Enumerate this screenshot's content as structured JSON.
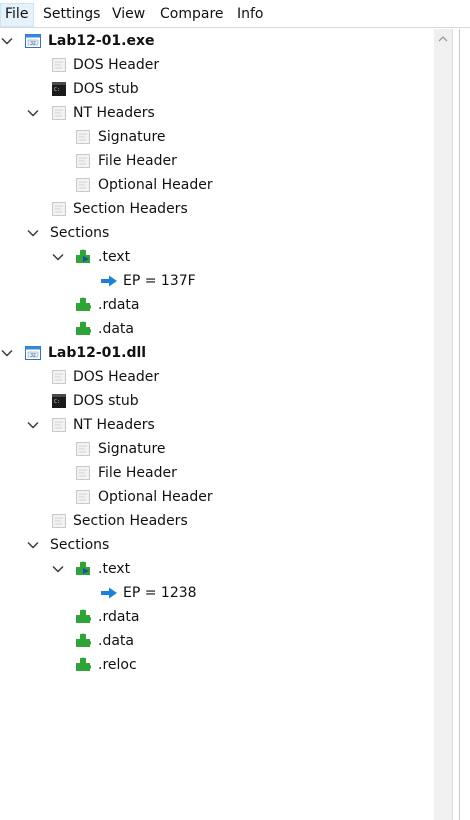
{
  "menu": {
    "items": [
      {
        "label": "File",
        "active": true
      },
      {
        "label": "Settings",
        "active": false
      },
      {
        "label": "View",
        "active": false
      },
      {
        "label": "Compare",
        "active": false
      },
      {
        "label": "Info",
        "active": false
      }
    ]
  },
  "tree": [
    {
      "label": "Lab12-01.exe",
      "level": 0,
      "icon": "exe-window-icon",
      "expand": "expanded",
      "bold": true
    },
    {
      "label": "DOS Header",
      "level": 1,
      "icon": "header-icon",
      "expand": "none"
    },
    {
      "label": "DOS stub",
      "level": 1,
      "icon": "console-icon",
      "expand": "none"
    },
    {
      "label": "NT Headers",
      "level": 1,
      "icon": "header-icon",
      "expand": "expanded"
    },
    {
      "label": "Signature",
      "level": 2,
      "icon": "header-icon",
      "expand": "none"
    },
    {
      "label": "File Header",
      "level": 2,
      "icon": "header-icon",
      "expand": "none"
    },
    {
      "label": "Optional Header",
      "level": 2,
      "icon": "header-icon",
      "expand": "none"
    },
    {
      "label": "Section Headers",
      "level": 1,
      "icon": "header-icon",
      "expand": "none"
    },
    {
      "label": "Sections",
      "level": 1,
      "icon": "",
      "expand": "expanded"
    },
    {
      "label": ".text",
      "level": 2,
      "icon": "entry-section-icon",
      "expand": "expanded"
    },
    {
      "label": "EP = 137F",
      "level": 3,
      "icon": "entry-point-arrow-icon",
      "expand": "none"
    },
    {
      "label": ".rdata",
      "level": 2,
      "icon": "section-icon",
      "expand": "none"
    },
    {
      "label": ".data",
      "level": 2,
      "icon": "section-icon",
      "expand": "none"
    },
    {
      "label": "Lab12-01.dll",
      "level": 0,
      "icon": "exe-window-icon",
      "expand": "expanded",
      "bold": true
    },
    {
      "label": "DOS Header",
      "level": 1,
      "icon": "header-icon",
      "expand": "none"
    },
    {
      "label": "DOS stub",
      "level": 1,
      "icon": "console-icon",
      "expand": "none"
    },
    {
      "label": "NT Headers",
      "level": 1,
      "icon": "header-icon",
      "expand": "expanded"
    },
    {
      "label": "Signature",
      "level": 2,
      "icon": "header-icon",
      "expand": "none"
    },
    {
      "label": "File Header",
      "level": 2,
      "icon": "header-icon",
      "expand": "none"
    },
    {
      "label": "Optional Header",
      "level": 2,
      "icon": "header-icon",
      "expand": "none"
    },
    {
      "label": "Section Headers",
      "level": 1,
      "icon": "header-icon",
      "expand": "none"
    },
    {
      "label": "Sections",
      "level": 1,
      "icon": "",
      "expand": "expanded"
    },
    {
      "label": ".text",
      "level": 2,
      "icon": "entry-section-icon",
      "expand": "expanded"
    },
    {
      "label": "EP = 1238",
      "level": 3,
      "icon": "entry-point-arrow-icon",
      "expand": "none"
    },
    {
      "label": ".rdata",
      "level": 2,
      "icon": "section-icon",
      "expand": "none"
    },
    {
      "label": ".data",
      "level": 2,
      "icon": "section-icon",
      "expand": "none"
    },
    {
      "label": ".reloc",
      "level": 2,
      "icon": "section-icon",
      "expand": "none"
    }
  ],
  "scrollbar": {
    "up_icon": "chevron-up-icon"
  },
  "colors": {
    "menu_active_bg": "#e5f1fb",
    "section_green": "#2fa33a",
    "arrow_blue": "#1e7fd8",
    "header_icon_gray": "#c8c8c8"
  }
}
